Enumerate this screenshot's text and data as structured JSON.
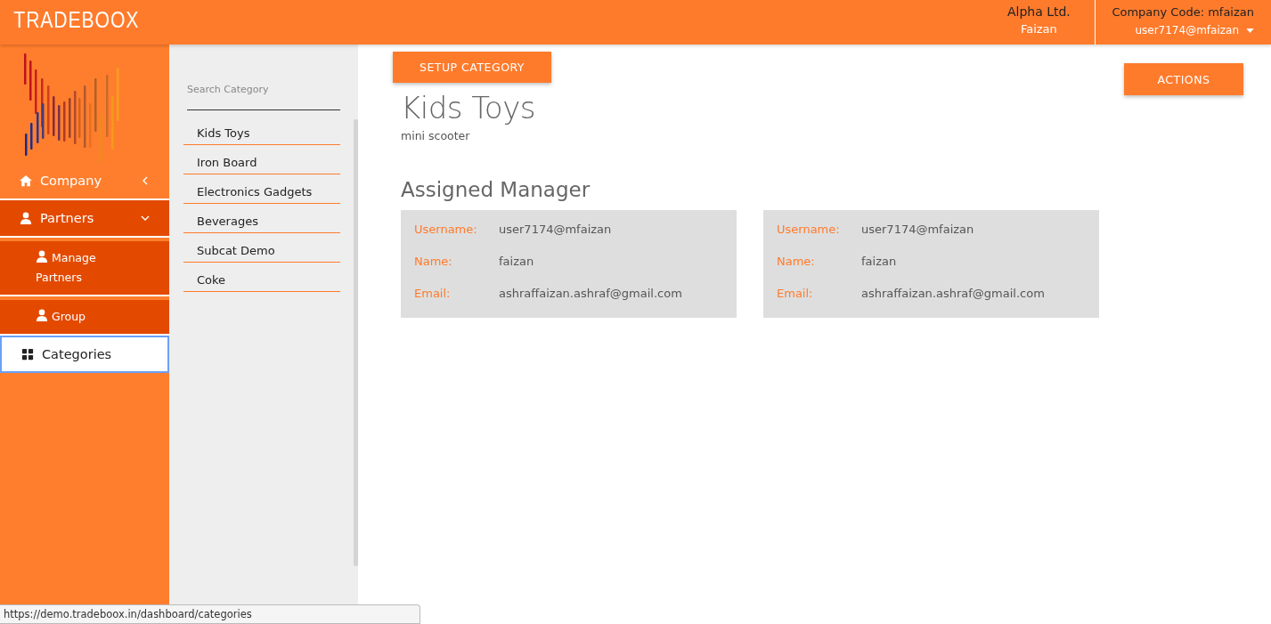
{
  "header": {
    "brand": "TRADEBOOX",
    "company": "Alpha Ltd.",
    "user_name": "Faizan",
    "company_code": "Company Code: mfaizan",
    "account": "user7174@mfaizan"
  },
  "sidebar": {
    "items": [
      {
        "label": "Company",
        "expanded": false,
        "selected": false
      },
      {
        "label": "Partners",
        "expanded": true,
        "selected": false,
        "children": [
          {
            "label": "Manage Partners",
            "selected": false
          },
          {
            "label": "Group",
            "selected": false
          }
        ]
      },
      {
        "label": "Categories",
        "selected": true
      }
    ]
  },
  "category_panel": {
    "search": {
      "placeholder": "Search Category"
    },
    "items": [
      "Kids Toys",
      "Iron Board",
      "Electronics Gadgets",
      "Beverages",
      "Subcat Demo",
      "Coke"
    ]
  },
  "main": {
    "setup_button": "SETUP CATEGORY",
    "title": "Kids Toys",
    "subtitle": "mini scooter",
    "actions_button": "ACTIONS",
    "section_title": "Assigned Manager",
    "managers": [
      {
        "fields": [
          {
            "label": "Username:",
            "value": "user7174@mfaizan"
          },
          {
            "label": "Name:",
            "value": "faizan"
          },
          {
            "label": "Email:",
            "value": "ashraffaizan.ashraf@gmail.com"
          }
        ]
      },
      {
        "fields": [
          {
            "label": "Username:",
            "value": "user7174@mfaizan"
          },
          {
            "label": "Name:",
            "value": "faizan"
          },
          {
            "label": "Email:",
            "value": "ashraffaizan.ashraf@gmail.com"
          }
        ]
      }
    ]
  },
  "status_url": "https://demo.tradeboox.in/dashboard/categories"
}
